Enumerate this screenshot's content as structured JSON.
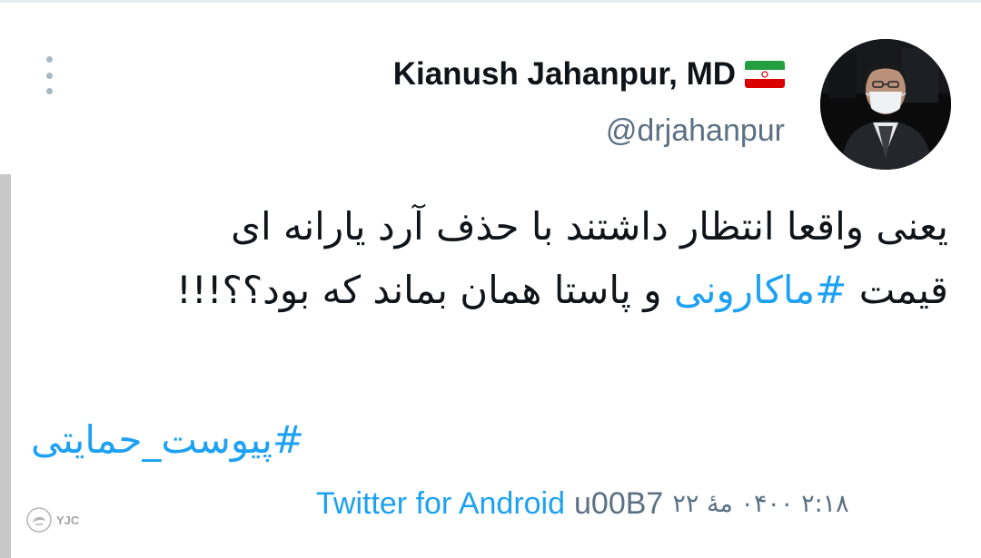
{
  "author": {
    "display_name": "Kianush Jahanpur, MD",
    "handle": "@drjahanpur",
    "flag_icon": "iran-flag-icon",
    "avatar_icon": "avatar-photo"
  },
  "menu": {
    "icon": "more-vertical-icon"
  },
  "tweet": {
    "line1": "یعنی واقعا انتظار داشتند با حذف آرد یارانه ای",
    "line2_before": "قیمت ",
    "line2_hashtag": "#ماکارونی",
    "line2_after": " و پاستا همان بماند که بود؟؟!!!",
    "hashtag2": "#پیوست_حمایتی"
  },
  "meta": {
    "source": "Twitter for Android",
    "code": "u00B7",
    "timestamp": "۲:۱۸ ۰۴۰۰ مهٔ ۲۲"
  },
  "watermark": {
    "text": "YJC"
  },
  "colors": {
    "link": "#1da1f2",
    "secondary_text": "#5b7083",
    "primary_text": "#0f1419",
    "menu_dots": "#aab8c2"
  }
}
